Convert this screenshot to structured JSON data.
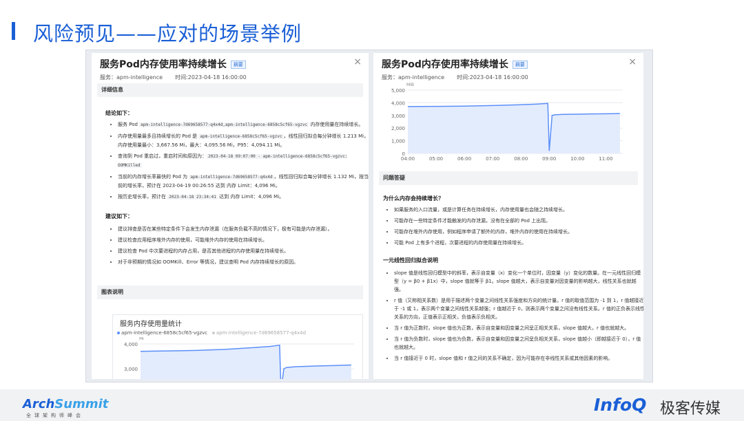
{
  "slide": {
    "title": "风险预见——应对的场景举例"
  },
  "left_panel": {
    "title": "服务Pod内存使用率持续增长",
    "tag": "摘要",
    "close": "×",
    "service": "服务：apm-intelligence",
    "time": "时间:2023-04-18 16:00:00",
    "section_detail": "详细信息",
    "conclusion_heading": "结论如下：",
    "conclusions": [
      {
        "a": "服务 Pod ",
        "code": "apm-intelligence-7d69658577-q4x4d,apm-intelligence-6858c5cf65-vgzvc",
        "b": " 内存使用量在持续增长。"
      },
      {
        "a": "内存使用量最多且持续增长的 Pod 是 ",
        "code": "apm-intelligence-6858c5cf65-vgzvc",
        "b": "，线性回归拟合每分钟增长 1.213 Mi，内存使用量最小：3,667.56 Mi，最大：4,095.56 Mi，P95：4,094.11 Mi。"
      },
      {
        "a": "查询到 Pod 重启过，重启时间和原因为：",
        "code": "2023-04-18 09:07:00 - apm-intelligence-6858c5cf65-vgzvc: OOMKilled",
        "b": ""
      },
      {
        "a": "当前的内存增长率最快的 Pod 为 ",
        "code": "apm-intelligence-7d69658577-q4x4d",
        "b": "，线性回归拟合每分钟增长 1.132 Mi，按当前的增长率，预计在 2023-04-19 00:26:55 达到 内存 Limit：4,096 Mi。"
      },
      {
        "a": "按历史增长率，预计在 ",
        "code": "2023-04-18 23:34:41",
        "b": " 达到 内存 Limit：4,096 Mi。"
      }
    ],
    "suggest_heading": "建议如下：",
    "suggestions": [
      "建议排查是否在某些特定条件下会发生内存泄漏（在服务负载不高的情况下，极有可能是内存泄漏）。",
      "建议检查应用程序堆外内存的使用，可能堆外内存的使用在持续增长。",
      "建议检查 Pod 中次要进程的内存占用，是否其他进程的内存使用量在持续增长。",
      "对于非预期的情况如 OOMKill、Error 等情况，建议查明 Pod 内存持续增长的原因。"
    ],
    "section_chart": "图表说明",
    "chart_title": "服务内存使用量统计",
    "legend": [
      "apm-intelligence-6858c5cf65-vgzvc",
      "apm-intelligence-7d69658577-q4x4d"
    ],
    "unit": "Mi"
  },
  "right_panel": {
    "title": "服务Pod内存使用率持续增长",
    "tag": "摘要",
    "close": "×",
    "service": "服务：apm-intelligence",
    "time": "时间:2023-04-18 16:00:00",
    "unit": "MiB",
    "section_qa": "问题答疑",
    "q1": "为什么内存会持续增长？",
    "a1": [
      "如果服务的入口流量，或是计算任务在持续增长，内存使用量也会随之持续增长。",
      "可能存在一些特定条件才能触发的内存泄漏，没有在全部的 Pod 上出现。",
      "可能存在堆外内存使用，例如程序申请了额外的内存，堆外内存的使用在持续增长。",
      "可能 Pod 上有多个进程，次要进程的内存使用量在持续增长。"
    ],
    "q2": "一元线性回归拟合说明",
    "a2": [
      "slope 值是线性回归模型中的斜率，表示自变量（x）变化一个单位时，因变量（y）变化的数量。在一元线性回归模型（y = β0 + β1x）中，slope 值就等于 β1。slope 值越大，表示自变量对因变量的影响越大，线性关系也就越强。",
      "r 值（又称相关系数）是用于描述两个变量之间线性关系强度和方向的统计量。r 值的取值范围为 -1 到 1，r 值越接近于 -1 或 1，表示两个变量之间线性关系越强；r 值越近于 0，则表示两个变量之间没有线性关系。r 值的正负表示线性关系的方向，正值表示正相关，负值表示负相关。",
      "当 r 值为正数时，slope 值也为正数，表示自变量和因变量之间呈正相关关系，slope 值越大，r 值也就越大。",
      "当 r 值为负数时，slope 值也为负数，表示自变量和因变量之间呈负相关关系，slope 值越小（即越接近于 0），r 值也就越大。",
      "当 r 值接近于 0 时，slope 值和 r 值之间的关系不确定，因为可能存在非线性关系或其他因素的影响。"
    ]
  },
  "footer": {
    "arch_a": "Arch",
    "arch_b": "Summit",
    "arch_sub": "全球架构师峰会",
    "infoq": "InfoQ",
    "infoq_cn": "极客传媒"
  },
  "chart_data": [
    {
      "type": "line",
      "title": "",
      "x": [
        "04:00",
        "05:00",
        "06:00",
        "07:00",
        "08:00",
        "09:00",
        "10:00",
        "11:00"
      ],
      "ylim": [
        0,
        5000
      ],
      "yticks": [
        0,
        1000,
        2000,
        3000,
        4000,
        5000
      ],
      "ylabel": "MiB",
      "series": [
        {
          "values_time": [
            4.0,
            4.5,
            5,
            6,
            7,
            8,
            8.6,
            8.95,
            9.0,
            9.1,
            9.2,
            9.5,
            10,
            10.5,
            11,
            11.5
          ],
          "values": [
            3700,
            3710,
            3720,
            3740,
            3780,
            3850,
            3900,
            3950,
            200,
            3000,
            3050,
            3080,
            3100,
            3120,
            3130,
            3150
          ]
        }
      ],
      "color": "#5b8ff9",
      "grid": true
    },
    {
      "type": "line",
      "title": "服务内存使用量统计",
      "ylim": [
        2000,
        4000
      ],
      "yticks": [
        2000,
        3000,
        4000
      ],
      "ylabel": "Mi",
      "series": [
        {
          "name": "apm-intelligence-6858c5cf65-vgzvc",
          "values_time": [
            4.0,
            4.5,
            5,
            6,
            7,
            8,
            8.6,
            8.95,
            9.0,
            9.1,
            9.2,
            9.5,
            10,
            10.5,
            11,
            11.5
          ],
          "values": [
            3700,
            3710,
            3720,
            3740,
            3780,
            3850,
            3900,
            3950,
            2100,
            3000,
            3050,
            3080,
            3100,
            3120,
            3130,
            3150
          ]
        }
      ],
      "color": "#5b8ff9",
      "grid": true
    }
  ],
  "colors": {
    "accent": "#1a5fd6",
    "series": "#5b8ff9",
    "area": "#e3ecfd"
  }
}
